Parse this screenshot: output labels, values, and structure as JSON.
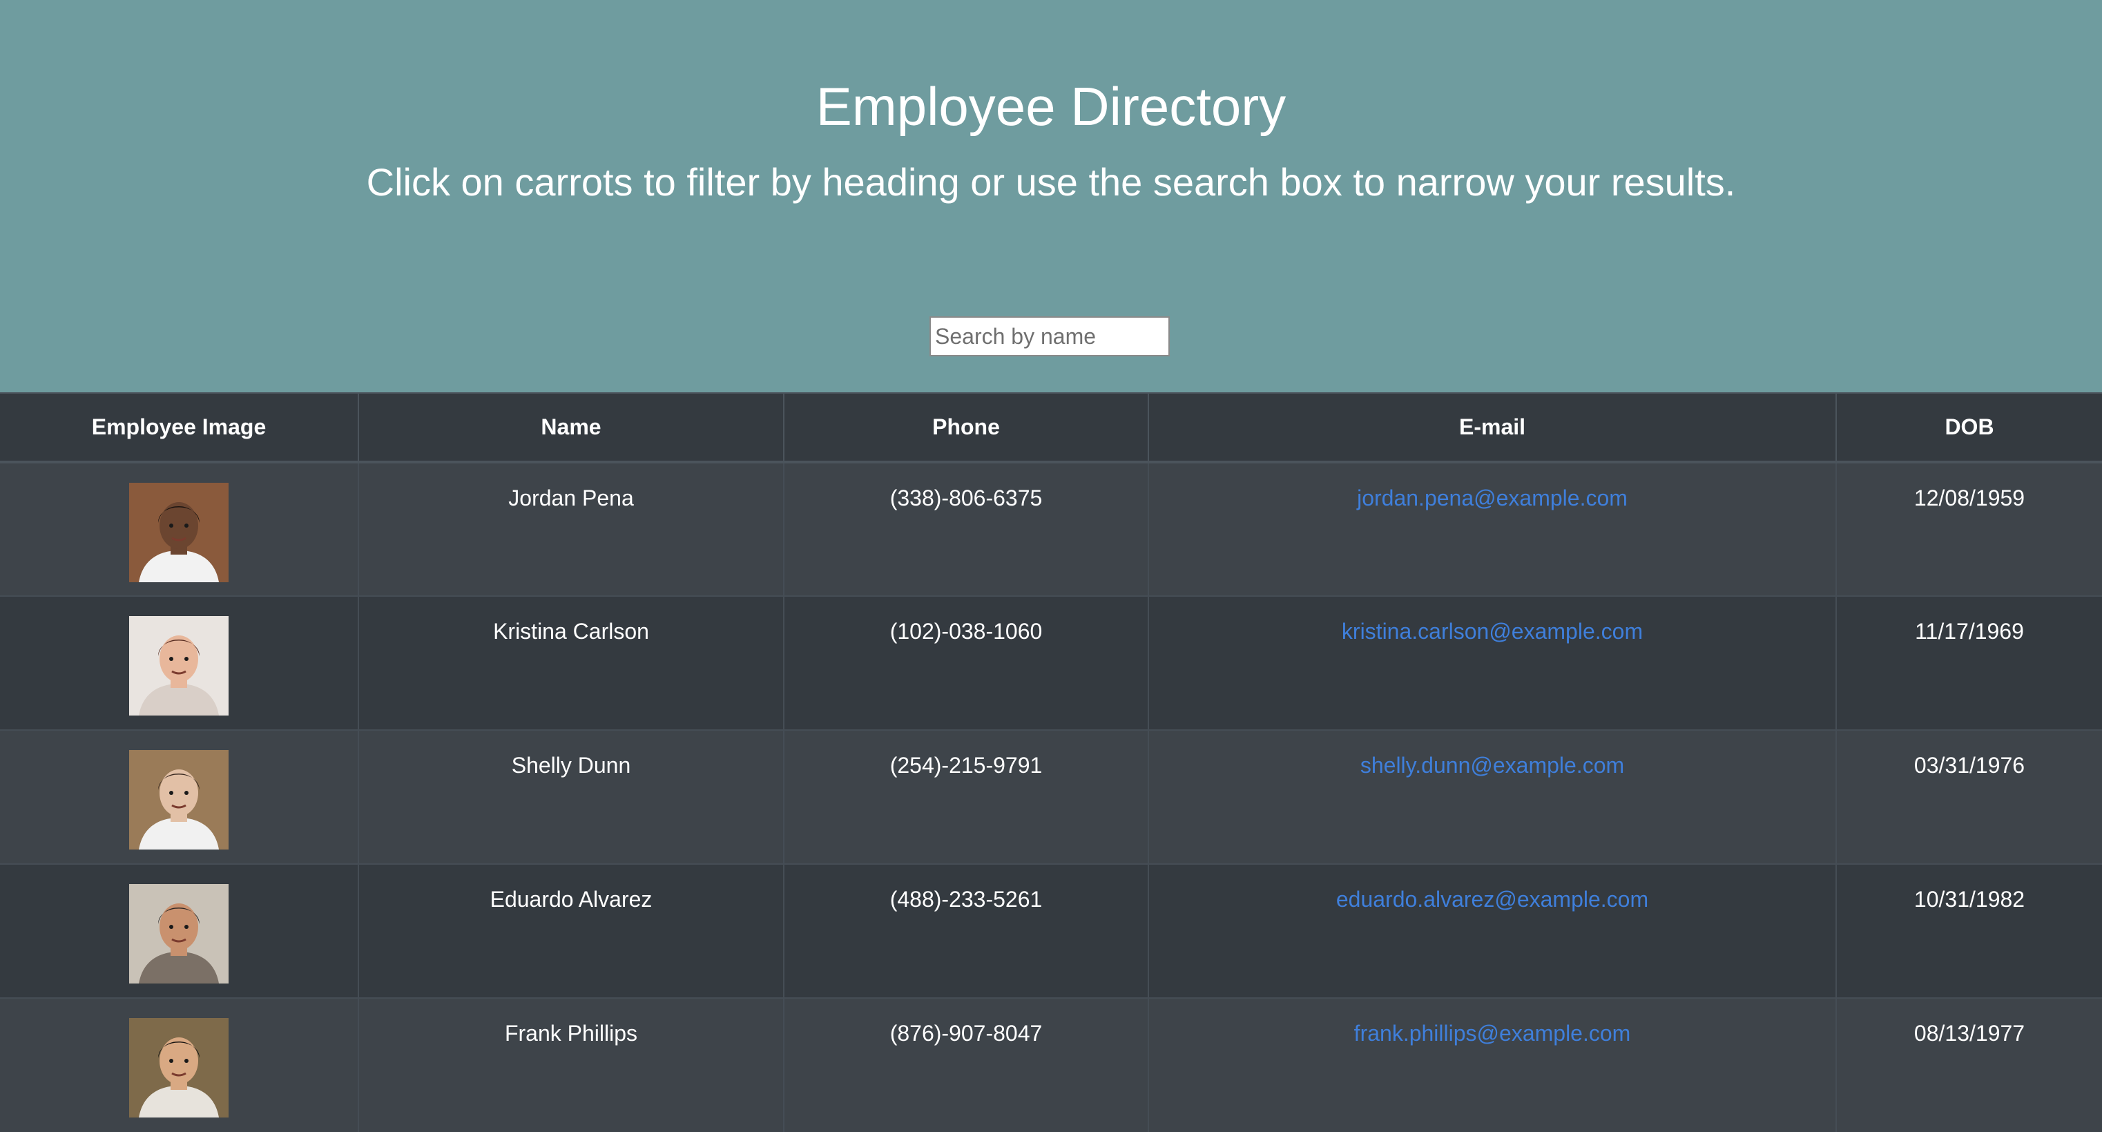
{
  "header": {
    "title": "Employee Directory",
    "subtitle": "Click on carrots to filter by heading or use the search box to narrow your results.",
    "search_placeholder": "Search by name",
    "search_value": ""
  },
  "table": {
    "columns": [
      "Employee Image",
      "Name",
      "Phone",
      "E-mail",
      "DOB"
    ],
    "rows": [
      {
        "name": "Jordan Pena",
        "phone": "(338)-806-6375",
        "email": "jordan.pena@example.com",
        "dob": "12/08/1959",
        "photo_colors": {
          "bg": "#8a5a3c",
          "skin": "#6b4530",
          "hair": "#1c1410",
          "shirt": "#f2f2f2"
        }
      },
      {
        "name": "Kristina Carlson",
        "phone": "(102)-038-1060",
        "email": "kristina.carlson@example.com",
        "dob": "11/17/1969",
        "photo_colors": {
          "bg": "#e9e4e0",
          "skin": "#e8b79b",
          "hair": "#5a2e22",
          "shirt": "#d9cfc8"
        }
      },
      {
        "name": "Shelly Dunn",
        "phone": "(254)-215-9791",
        "email": "shelly.dunn@example.com",
        "dob": "03/31/1976",
        "photo_colors": {
          "bg": "#9a7b58",
          "skin": "#e2c0a6",
          "hair": "#3a2a22",
          "shirt": "#f1f1f1"
        }
      },
      {
        "name": "Eduardo Alvarez",
        "phone": "(488)-233-5261",
        "email": "eduardo.alvarez@example.com",
        "dob": "10/31/1982",
        "photo_colors": {
          "bg": "#c9c2b7",
          "skin": "#c9916e",
          "hair": "#2b2624",
          "shirt": "#7b7066"
        }
      },
      {
        "name": "Frank Phillips",
        "phone": "(876)-907-8047",
        "email": "frank.phillips@example.com",
        "dob": "08/13/1977",
        "photo_colors": {
          "bg": "#7e6a4a",
          "skin": "#d9a983",
          "hair": "#161311",
          "shirt": "#e7e3dc"
        }
      }
    ]
  },
  "colors": {
    "hero_bg": "#6f9c9f",
    "table_bg": "#343a40",
    "table_stripe": "#3e444a",
    "link": "#3f7fdb"
  }
}
